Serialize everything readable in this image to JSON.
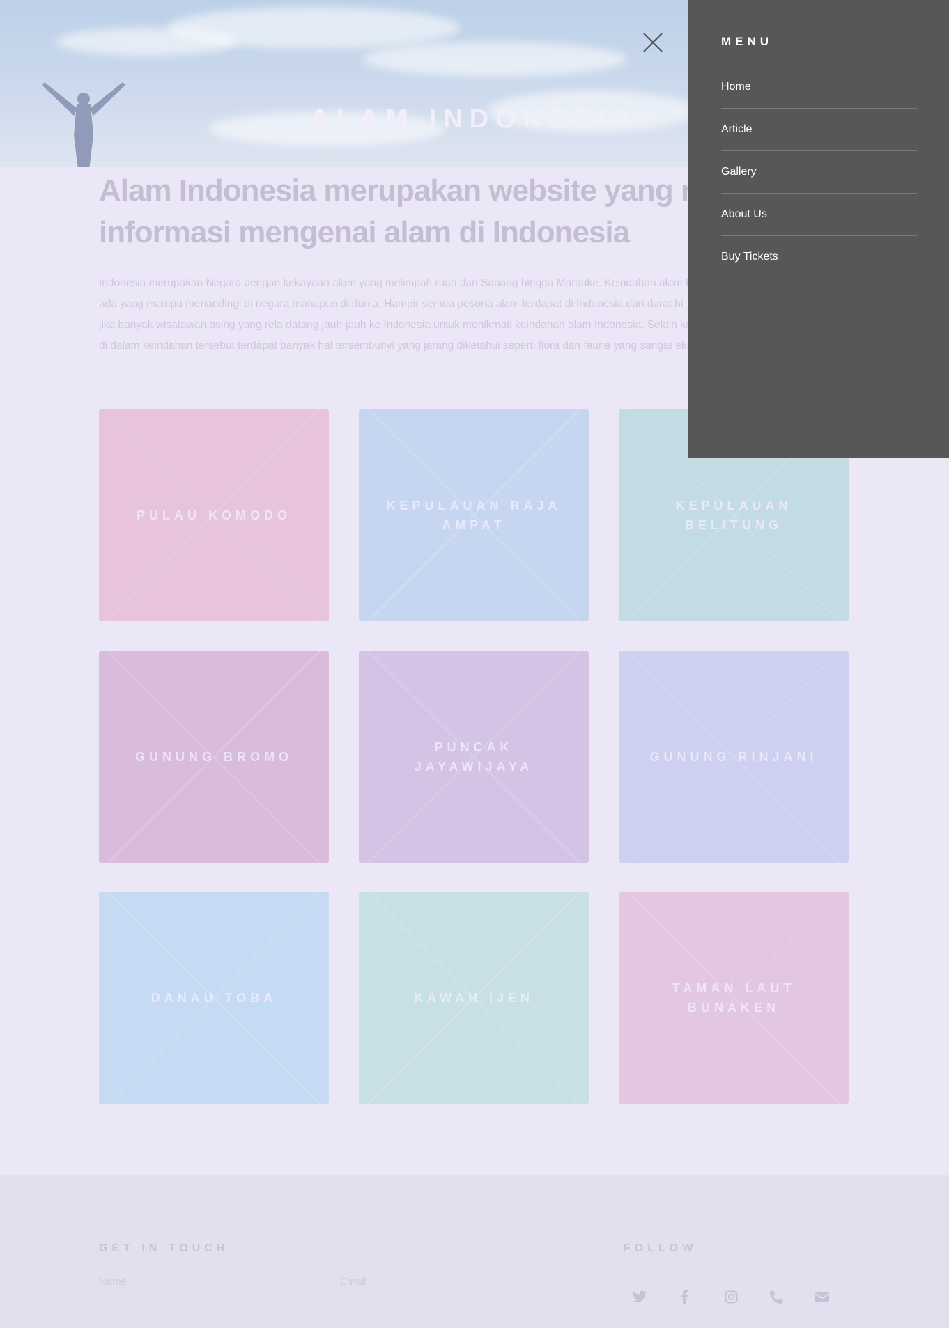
{
  "hero": {
    "title": "ALAM INDONESIA"
  },
  "intro": {
    "heading_line1": "Alam Indonesia merupakan website yang me",
    "heading_line2": "informasi mengenai alam di Indonesia",
    "text_lines": [
      "Indonesia merupakan Negara dengan kekayaan alam yang melimpah ruah dari Sabang hingga Marauke. Keindahan alam In",
      "ada yang mampu menandingi di negara manapun di dunia. Hampir semua pesona alam terdapat di Indonesia dari darat hi",
      "jika banyak wisatawan asing yang rela datang jauh-jauh ke Indonesia untuk menikmati keindahan alam Indonesia. Selain ke",
      "di dalam keindahan tersebut terdapat banyak hal tersembunyi yang jarang diketahui seperti flora dan fauna yang sangat eks"
    ]
  },
  "destinations": [
    {
      "label": "PULAU KOMODO",
      "color": "#e7c3de"
    },
    {
      "label": "KEPULAUAN RAJA AMPAT",
      "color": "#c6d6f1"
    },
    {
      "label": "KEPULAUAN BELITUNG",
      "color": "#c3dbe3"
    },
    {
      "label": "GUNUNG BROMO",
      "color": "#d9bcdb"
    },
    {
      "label": "PUNCAK JAYAWIJAYA",
      "color": "#d4c3e5"
    },
    {
      "label": "GUNUNG RINJANI",
      "color": "#cdd0f0"
    },
    {
      "label": "DANAU TOBA",
      "color": "#c6daf3"
    },
    {
      "label": "KAWAH IJEN",
      "color": "#c9dfe6"
    },
    {
      "label": "TAMAN LAUT BUNAKEN",
      "color": "#e3c6e0"
    }
  ],
  "footer": {
    "contact_heading": "GET IN TOUCH",
    "follow_heading": "FOLLOW",
    "name_placeholder": "Name",
    "email_placeholder": "Email",
    "socials": [
      "twitter-icon",
      "facebook-icon",
      "instagram-icon",
      "phone-icon",
      "envelope-icon"
    ]
  },
  "menu": {
    "heading": "MENU",
    "items": [
      "Home",
      "Article",
      "Gallery",
      "About Us",
      "Buy Tickets"
    ],
    "close_icon": "close-icon",
    "panel_color": "#575757"
  }
}
